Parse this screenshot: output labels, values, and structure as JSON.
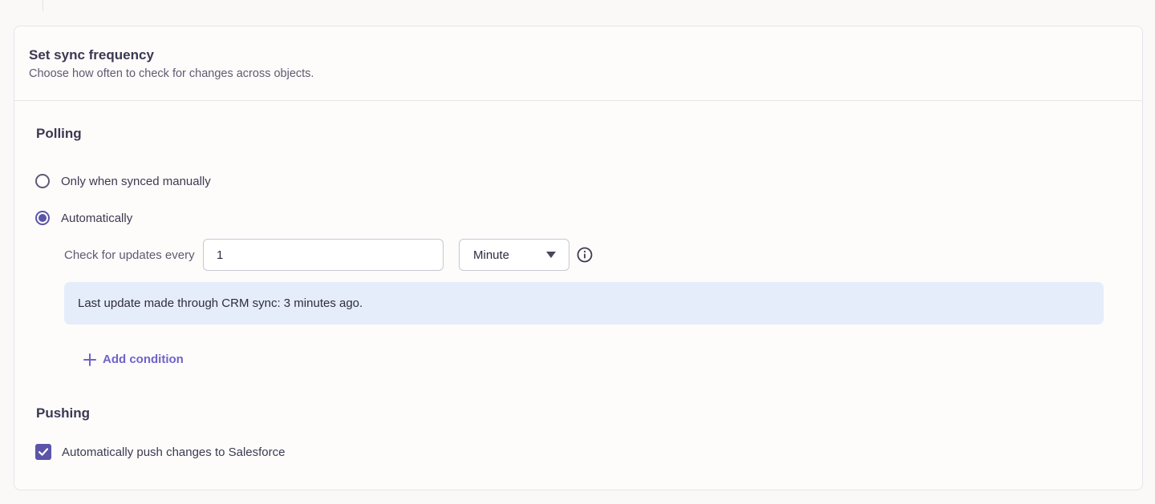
{
  "card": {
    "title": "Set sync frequency",
    "subtitle": "Choose how often to check for changes across objects."
  },
  "polling": {
    "title": "Polling",
    "options": [
      {
        "label": "Only when synced manually",
        "selected": false
      },
      {
        "label": "Automatically",
        "selected": true
      }
    ],
    "frequency_label": "Check for updates every",
    "frequency_value": "1",
    "unit_value": "Minute",
    "info_icon": "info-circle-icon",
    "banner_text": "Last update made through CRM sync: 3 minutes ago.",
    "add_condition_label": "Add condition"
  },
  "pushing": {
    "title": "Pushing",
    "checkbox_label": "Automatically push changes to Salesforce",
    "checked": true
  },
  "colors": {
    "accent": "#5b55a8",
    "link": "#6e63c9",
    "banner_bg": "#e5edfb"
  }
}
